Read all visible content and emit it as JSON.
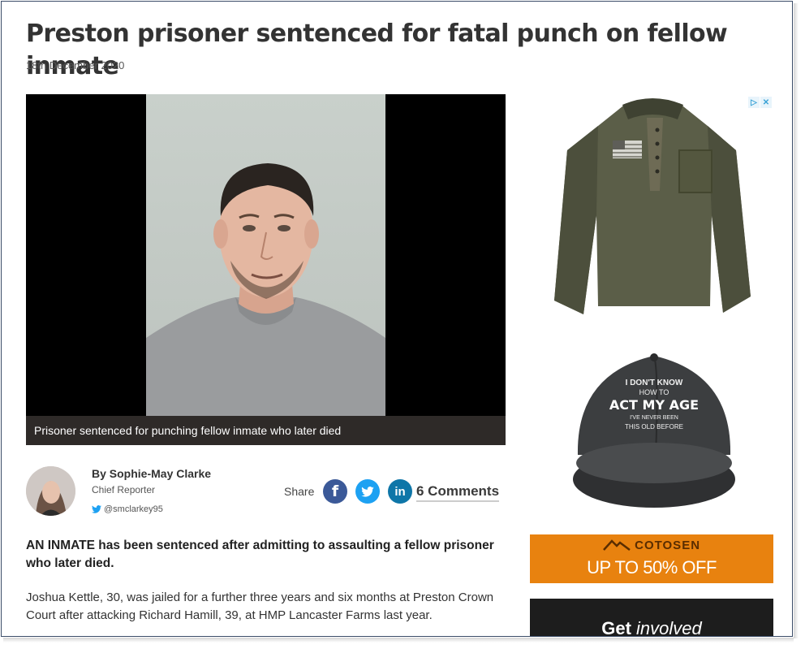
{
  "article": {
    "headline": "Preston prisoner sentenced for fatal punch on fellow inmate",
    "date": "18th December 2020",
    "image_caption": "Prisoner sentenced for punching fellow inmate who later died",
    "author": "By Sophie-May Clarke",
    "author_role": "Chief Reporter",
    "author_twitter": "@smclarkey95",
    "share_label": "Share",
    "comments_label": "6 Comments",
    "lead": "AN INMATE has been sentenced after admitting to assaulting a fellow prisoner who later died.",
    "body_p1": "Joshua Kettle, 30, was jailed for a further three years and six months at Preston Crown Court after attacking Richard Hamill, 39, at HMP Lancaster Farms last year."
  },
  "social": {
    "facebook": {
      "glyph": "f",
      "color": "#3b5998"
    },
    "twitter": {
      "glyph": "t",
      "color": "#1da1f2"
    },
    "linkedin": {
      "glyph": "in",
      "color": "#0e76a8"
    }
  },
  "ads": {
    "cap_text_1": "I DON'T KNOW",
    "cap_text_2": "HOW TO",
    "cap_text_3": "ACT MY AGE",
    "cap_text_4": "I'VE NEVER BEEN",
    "cap_text_5": "THIS OLD BEFORE",
    "banner_brand": "COTOSEN",
    "banner_offer": "UP TO 50% OFF",
    "get_involved_bold": "Get",
    "get_involved_italic": "involved"
  },
  "colors": {
    "accent_orange": "#e8820f",
    "caption_bg": "#2e2a28"
  }
}
